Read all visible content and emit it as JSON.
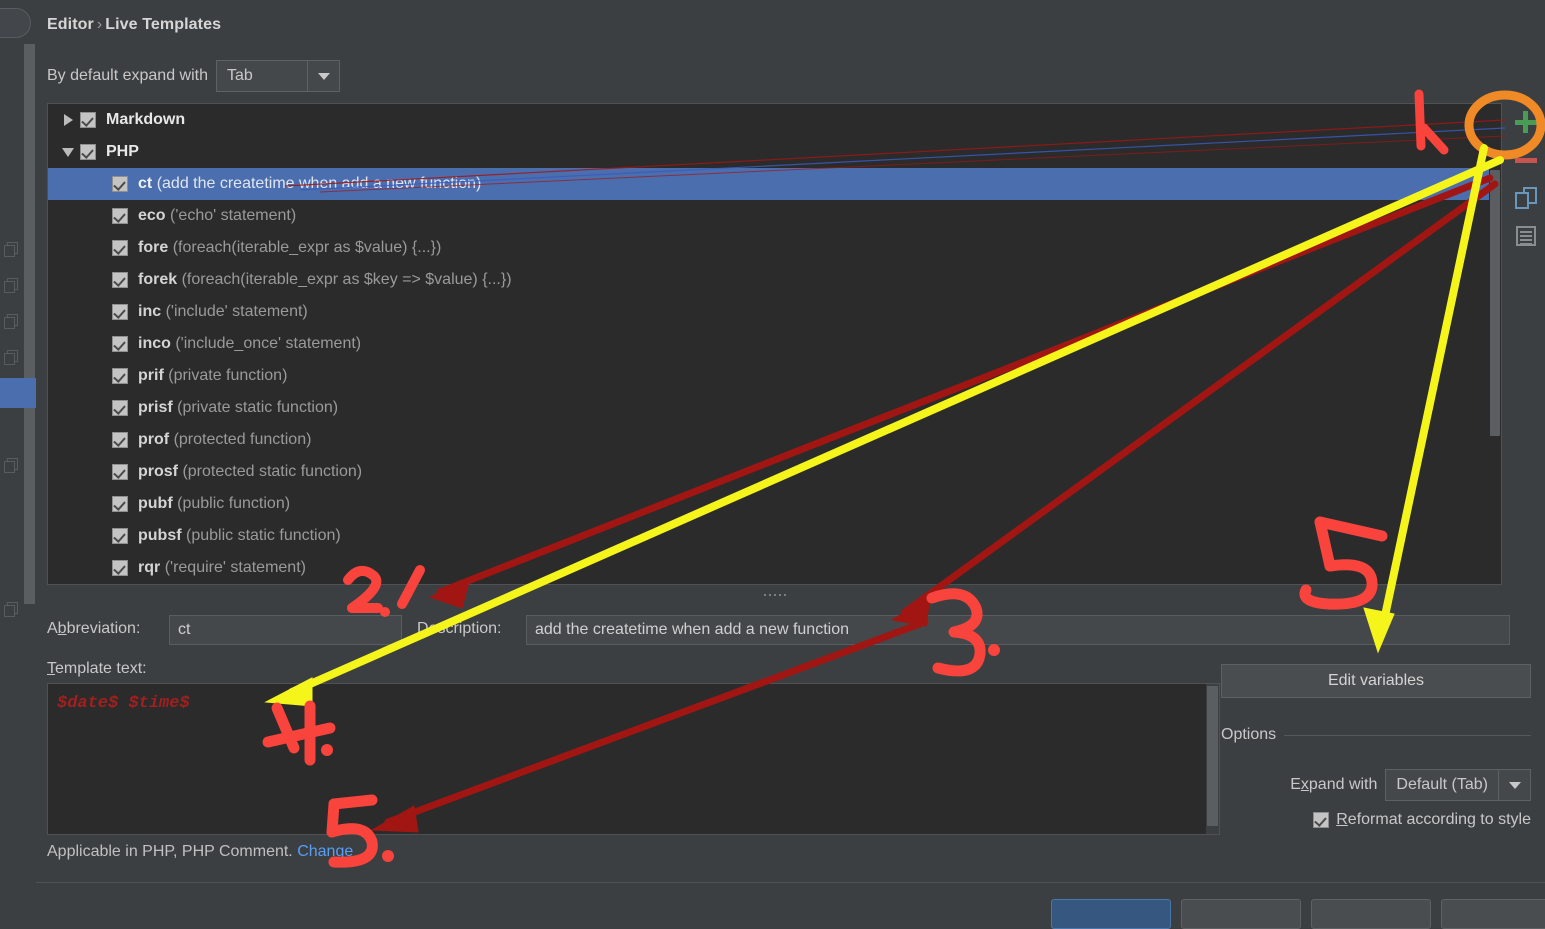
{
  "breadcrumb": {
    "root": "Editor",
    "separator": "›",
    "current": "Live Templates"
  },
  "expand_default": {
    "label": "By default expand with",
    "value": "Tab",
    "icon": "chevron-down-icon"
  },
  "toolbar": {
    "add": {
      "icon": "plus-icon",
      "color": "#499c54"
    },
    "remove": {
      "icon": "minus-icon",
      "color": "#c75450"
    },
    "duplicate": {
      "icon": "copy-icon",
      "color": "#6897bb"
    },
    "edit_group": {
      "icon": "document-list-icon",
      "color": "#8a8d8f"
    }
  },
  "templates": [
    {
      "type": "group",
      "twisty": "collapsed",
      "checked": true,
      "name": "Markdown",
      "desc": ""
    },
    {
      "type": "group",
      "twisty": "expanded",
      "checked": true,
      "name": "PHP",
      "desc": ""
    },
    {
      "type": "item",
      "checked": true,
      "selected": true,
      "abbr": "ct",
      "desc": "(add the createtime when add a new function)"
    },
    {
      "type": "item",
      "checked": true,
      "abbr": "eco",
      "desc": "('echo' statement)"
    },
    {
      "type": "item",
      "checked": true,
      "abbr": "fore",
      "desc": "(foreach(iterable_expr as $value) {...})"
    },
    {
      "type": "item",
      "checked": true,
      "abbr": "forek",
      "desc": "(foreach(iterable_expr as $key => $value) {...})"
    },
    {
      "type": "item",
      "checked": true,
      "abbr": "inc",
      "desc": "('include' statement)"
    },
    {
      "type": "item",
      "checked": true,
      "abbr": "inco",
      "desc": "('include_once' statement)"
    },
    {
      "type": "item",
      "checked": true,
      "abbr": "prif",
      "desc": "(private function)"
    },
    {
      "type": "item",
      "checked": true,
      "abbr": "prisf",
      "desc": "(private static function)"
    },
    {
      "type": "item",
      "checked": true,
      "abbr": "prof",
      "desc": "(protected function)"
    },
    {
      "type": "item",
      "checked": true,
      "abbr": "prosf",
      "desc": "(protected static function)"
    },
    {
      "type": "item",
      "checked": true,
      "abbr": "pubf",
      "desc": "(public function)"
    },
    {
      "type": "item",
      "checked": true,
      "abbr": "pubsf",
      "desc": "(public static function)"
    },
    {
      "type": "item",
      "checked": true,
      "abbr": "rqr",
      "desc": "('require' statement)"
    }
  ],
  "form": {
    "abbreviation_label": "Abbreviation:",
    "abbreviation_mnemonic": "b",
    "abbreviation_value": "ct",
    "description_label": "Description:",
    "description_mnemonic": "D",
    "description_value": "add the createtime when add a new function",
    "template_text_label": "Template text:",
    "template_text_mnemonic": "T",
    "template_text_value": "$date$ $time$"
  },
  "applicable": {
    "text": "Applicable in PHP, PHP Comment.",
    "link": "Change"
  },
  "options": {
    "edit_variables_label": "Edit variables",
    "group_title": "Options",
    "expand_with_label": "Expand with",
    "expand_with_mnemonic": "x",
    "expand_with_value": "Default (Tab)",
    "reformat_label": "Reformat according to style",
    "reformat_mnemonic": "R",
    "reformat_checked": true
  },
  "annotations": {
    "colors": {
      "red": "#f8443c",
      "dark_red": "#a11613",
      "yellow": "#f5f51c",
      "orange": "#f08a26"
    },
    "marks": [
      {
        "label": "1.",
        "target": "add-template-button"
      },
      {
        "label": "2.",
        "target": "abbreviation-field"
      },
      {
        "label": "3.",
        "target": "description-field"
      },
      {
        "label": "4.",
        "target": "template-text-area"
      },
      {
        "label": "5.",
        "target": "applicable-change-link"
      },
      {
        "label": "5",
        "target": "edit-variables-button"
      }
    ]
  }
}
